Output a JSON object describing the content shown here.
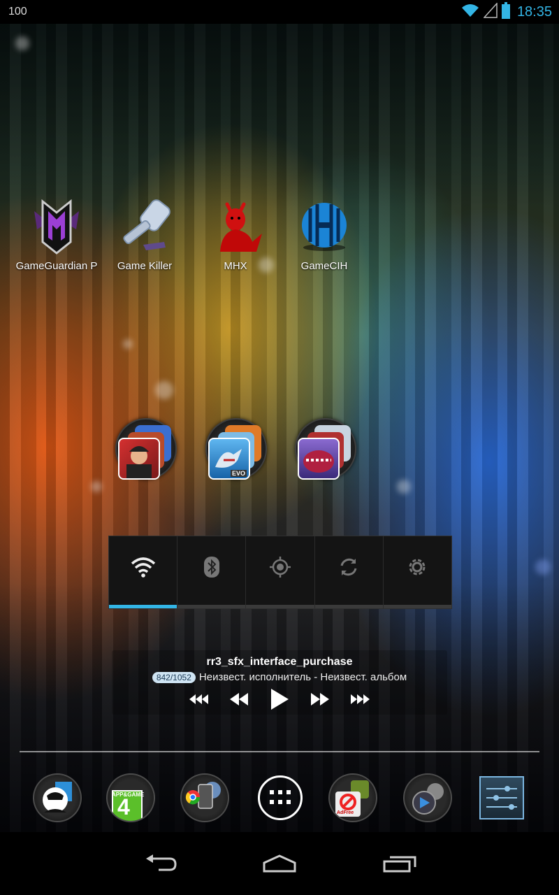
{
  "status_bar": {
    "battery_text": "100",
    "time": "18:35",
    "icons": [
      "wifi-icon",
      "signal-icon",
      "battery-icon"
    ]
  },
  "desktop_icons": [
    {
      "name": "gameguardian",
      "label": "GameGuardian P"
    },
    {
      "name": "game-killer",
      "label": "Game Killer"
    },
    {
      "name": "mhx",
      "label": "MHX"
    },
    {
      "name": "gamecih",
      "label": "GameCIH"
    }
  ],
  "folders": [
    {
      "name": "folder-1"
    },
    {
      "name": "folder-2",
      "badge_text": "EVO"
    },
    {
      "name": "folder-3"
    }
  ],
  "power_control": {
    "toggles": [
      {
        "name": "wifi",
        "icon": "wifi-icon",
        "on": true
      },
      {
        "name": "bluetooth",
        "icon": "bluetooth-icon",
        "on": false
      },
      {
        "name": "gps",
        "icon": "gps-icon",
        "on": false
      },
      {
        "name": "sync",
        "icon": "sync-icon",
        "on": false
      },
      {
        "name": "brightness",
        "icon": "brightness-icon",
        "on": false
      }
    ],
    "accent_color": "#33b5e5"
  },
  "music_widget": {
    "title": "rr3_sfx_interface_purchase",
    "counter": "842/1052",
    "subtitle": "Неизвест. исполнитель - Неизвест. альбом",
    "controls": [
      "skip-back-icon",
      "rewind-icon",
      "play-icon",
      "fast-forward-icon",
      "skip-forward-icon"
    ]
  },
  "dock": {
    "items": [
      "anonymous-app-icon",
      "appgame4-icon",
      "chrome-folder-icon",
      "app-drawer-icon",
      "adfree-folder-icon",
      "media-folder-icon",
      "settings-icon"
    ],
    "app_game_text": "APP&GAME",
    "app_game_number": "4",
    "adfree_text": "AdFree"
  },
  "nav_bar": {
    "buttons": [
      "back-icon",
      "home-icon",
      "recents-icon"
    ]
  }
}
